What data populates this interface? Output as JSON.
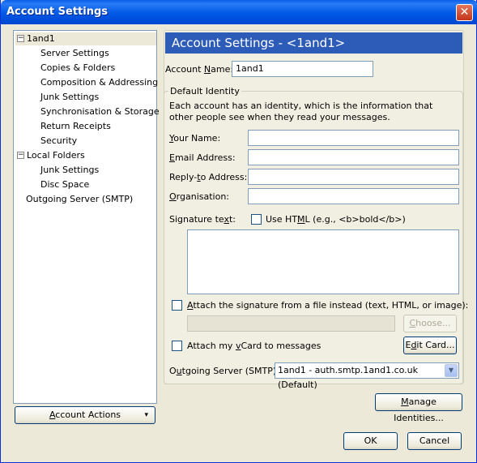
{
  "window": {
    "title": "Account Settings",
    "close_label": "✕"
  },
  "tree": {
    "nodes": [
      {
        "label": "1and1",
        "expanded": true,
        "selected": true
      },
      {
        "label": "Server Settings"
      },
      {
        "label": "Copies & Folders"
      },
      {
        "label": "Composition & Addressing"
      },
      {
        "label": "Junk Settings"
      },
      {
        "label": "Synchronisation & Storage"
      },
      {
        "label": "Return Receipts"
      },
      {
        "label": "Security"
      },
      {
        "label": "Local Folders",
        "expanded": true
      },
      {
        "label": "Junk Settings"
      },
      {
        "label": "Disc Space"
      },
      {
        "label": "Outgoing Server (SMTP)"
      }
    ],
    "expander_symbol": "−"
  },
  "account_actions": {
    "label_pre": "",
    "label_u": "A",
    "label_post": "ccount Actions",
    "arrow": "▾"
  },
  "panel": {
    "header": "Account Settings - <1and1>",
    "account_name_label_pre": "Account ",
    "account_name_label_u": "N",
    "account_name_label_post": "ame:",
    "account_name_value": "1and1",
    "identity_group_title": "Default Identity",
    "identity_description": "Each account has an identity, which is the information that other people see when they read your messages.",
    "your_name_label_u": "Y",
    "your_name_label_post": "our Name:",
    "email_label_u": "E",
    "email_label_post": "mail Address:",
    "reply_label_pre": "Reply-",
    "reply_label_u": "t",
    "reply_label_post": "o Address:",
    "org_label_u": "O",
    "org_label_post": "rganisation:",
    "signature_label_pre": "Signature te",
    "signature_label_u": "x",
    "signature_label_post": "t:",
    "use_html_pre": "Use HT",
    "use_html_u": "M",
    "use_html_post": "L (e.g., <b>bold</b>)",
    "attach_sig_u": "A",
    "attach_sig_post": "ttach the signature from a file instead (text, HTML, or image):",
    "choose_pre": "",
    "choose_u": "C",
    "choose_post": "hoose...",
    "attach_vcard_pre": "Attach my ",
    "attach_vcard_u": "v",
    "attach_vcard_post": "Card to messages",
    "edit_card_pre": "E",
    "edit_card_u": "d",
    "edit_card_post": "it Card...",
    "smtp_label_pre": "O",
    "smtp_label_u": "u",
    "smtp_label_post": "tgoing Server (SMTP):",
    "smtp_value": "1and1 - auth.smtp.1and1.co.uk (Default)",
    "manage_identities_pre": "",
    "manage_identities_u": "M",
    "manage_identities_post": "anage Identities..."
  },
  "buttons": {
    "ok": "OK",
    "cancel": "Cancel"
  }
}
